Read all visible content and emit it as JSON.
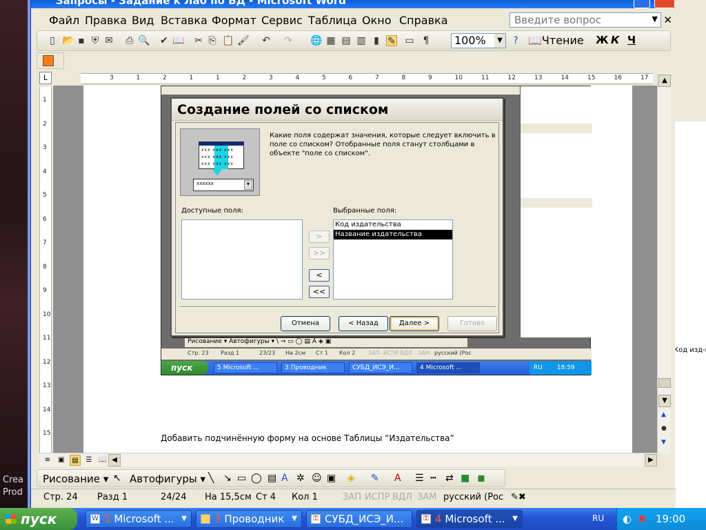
{
  "window": {
    "title": "Запросы - Задание к Лаб по БД - Microsoft Word",
    "menu": [
      "Файл",
      "Правка",
      "Вид",
      "Вставка",
      "Формат",
      "Сервис",
      "Таблица",
      "Окно",
      "Справка"
    ],
    "ask_placeholder": "Введите вопрос",
    "zoom": "100%",
    "read_label": "Чтение",
    "format_buttons": [
      "Ж",
      "К",
      "Ч"
    ]
  },
  "ruler": {
    "h_ticks": [
      "3",
      "1",
      "2",
      "1",
      "1",
      "2",
      "3",
      "4",
      "5",
      "6",
      "7",
      "8",
      "9",
      "10",
      "11",
      "12",
      "13",
      "14",
      "15",
      "16",
      "17"
    ],
    "v_ticks": [
      "1",
      "2",
      "3",
      "4",
      "5",
      "6",
      "7",
      "8",
      "9",
      "10",
      "11",
      "12",
      "13",
      "14",
      "15"
    ]
  },
  "document": {
    "text": "Добавить подчинённую форму  на основе Таблицы “Издательства”"
  },
  "dialog": {
    "title": "Создание полей со списком",
    "description": "Какие поля содержат значения, которые следует включить в поле со списком? Отобранные поля станут столбцами в объекте \"поле со списком\".",
    "pic_combo": "xxxxxx",
    "pic_rows": [
      "xxx xxx xxx",
      "xxx xxx xxx",
      "xxx xxx xxx"
    ],
    "available_label": "Доступные поля:",
    "selected_label": "Выбранные поля:",
    "available_fields": [],
    "selected_fields": [
      "Код издательства",
      "Название издательства"
    ],
    "move_buttons": [
      ">",
      ">>",
      "<",
      "<<"
    ],
    "buttons": {
      "cancel": "Отмена",
      "back": "< Назад",
      "next": "Далее >",
      "finish": "Готово"
    }
  },
  "embedded": {
    "draw_label": "Рисование",
    "autoshapes": "Автофигуры",
    "status": [
      "Стр. 23",
      "Разд 1",
      "23/23",
      "На 2см",
      "Ст 1",
      "Кол 2",
      "ЗАП",
      "ИСПР",
      "ВДЛ",
      "ЗАМ",
      "русский (Рос"
    ],
    "start": "пуск",
    "tasks": [
      "5 Microsoft ...",
      "3 Проводник",
      "СУБД_ИСЭ_И...",
      "4 Microsoft ..."
    ],
    "tray_lang": "RU",
    "clock": "18:59"
  },
  "drawbar": {
    "draw": "Рисование",
    "autoshapes": "Автофигуры"
  },
  "status": {
    "page": "Стр. 24",
    "section": "Разд 1",
    "pages": "24/24",
    "at": "На 15,5см",
    "line": "Ст 4",
    "col": "Кол 1",
    "rec": "ЗАП",
    "trk": "ИСПР",
    "ext": "ВДЛ",
    "ovr": "ЗАМ",
    "lang": "русский (Рос"
  },
  "taskbar": {
    "start": "пуск",
    "tasks": [
      {
        "num": "5",
        "label": " Microsoft ..."
      },
      {
        "num": "3",
        "label": " Проводник"
      },
      {
        "num": "",
        "label": "СУБД_ИСЭ_И..."
      },
      {
        "num": "4",
        "label": " Microsoft ..."
      }
    ],
    "lang": "RU",
    "clock": "19:00"
  },
  "desktop_labels": [
    "Crea",
    "Prod"
  ],
  "right_window_text": "Код изд-в"
}
